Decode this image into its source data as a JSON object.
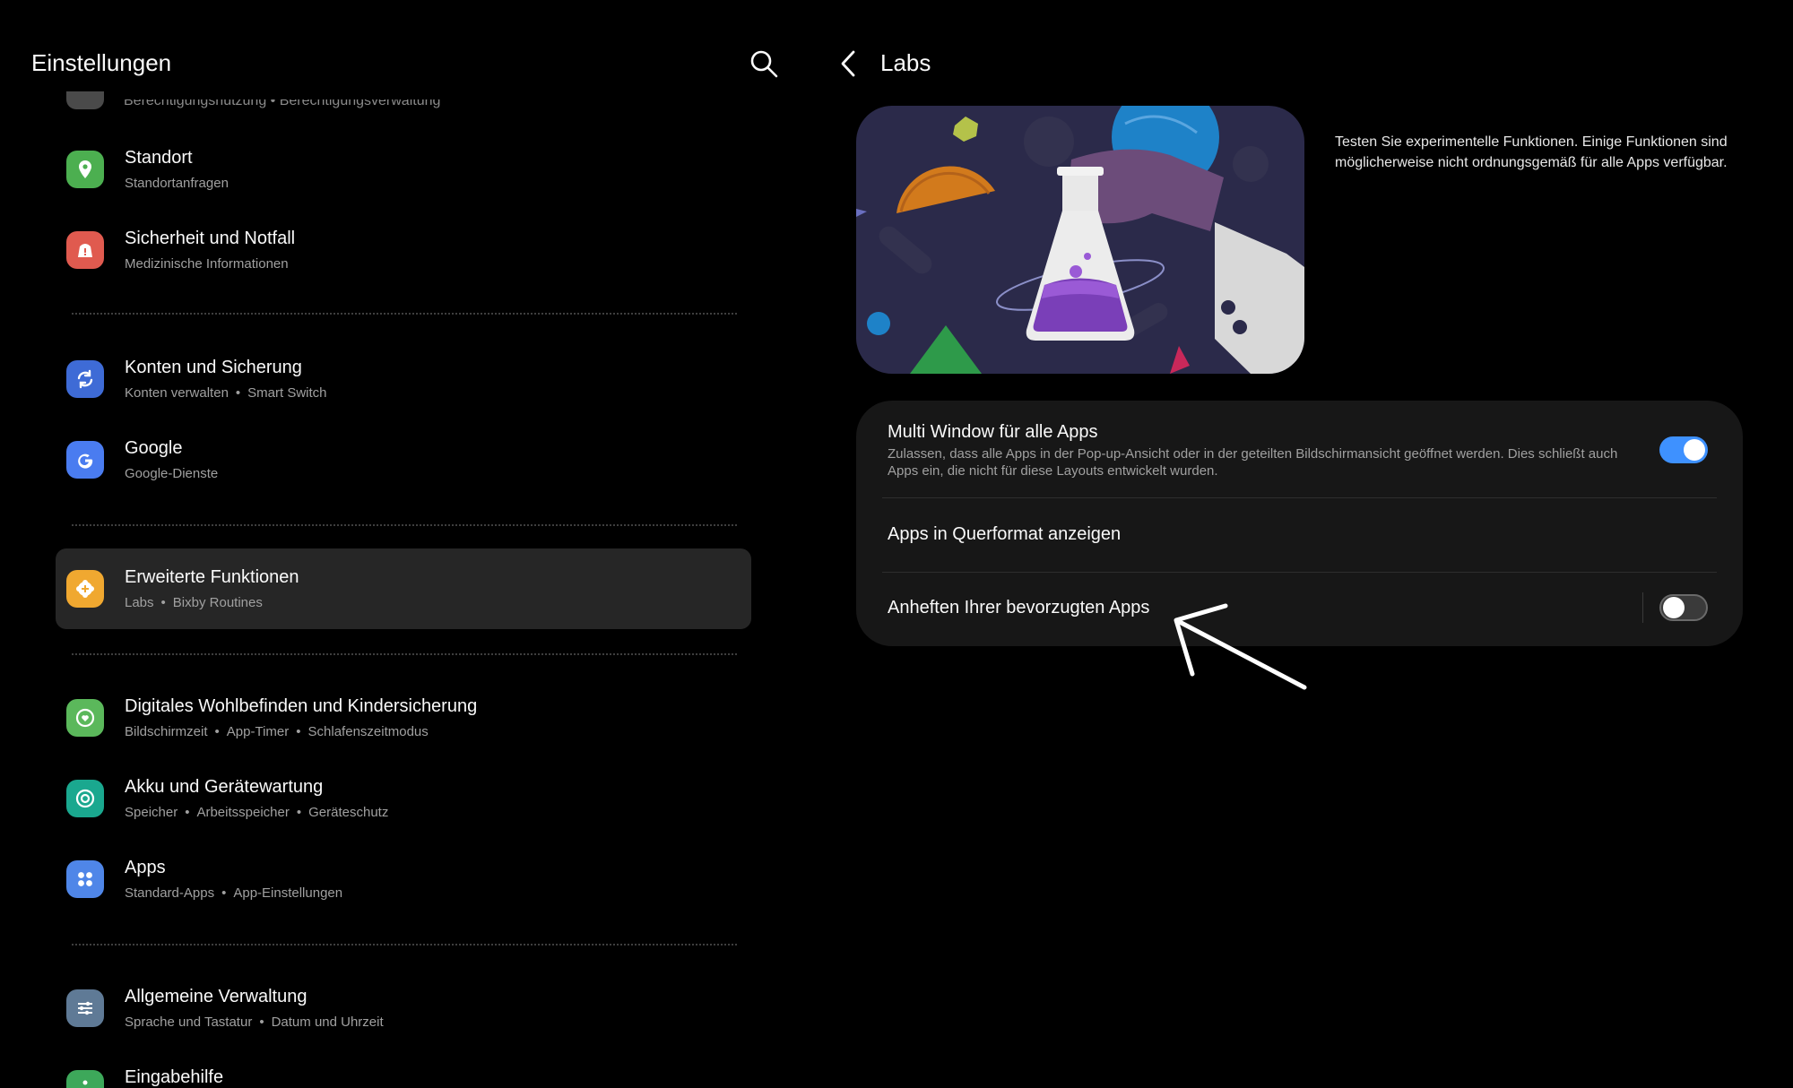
{
  "colors": {
    "background": "#000000",
    "selected_row": "#262626",
    "card": "#171717",
    "toggle_on": "#3e91ff",
    "toggle_off": "#3a3a3a"
  },
  "left": {
    "title": "Einstellungen",
    "search_icon": "search-icon",
    "clipped_item_text": "Berechtigungsnutzung • Berechtigungsverwaltung",
    "items": [
      {
        "id": "standort",
        "title": "Standort",
        "subtitle": [
          "Standortanfragen"
        ],
        "icon": "location-pin-icon",
        "icon_color": "#4caf50"
      },
      {
        "id": "sicherheit",
        "title": "Sicherheit und Notfall",
        "subtitle": [
          "Medizinische Informationen"
        ],
        "icon": "emergency-icon",
        "icon_color": "#e05a4f"
      },
      {
        "id": "konten",
        "title": "Konten und Sicherung",
        "subtitle": [
          "Konten verwalten",
          "Smart Switch"
        ],
        "icon": "sync-icon",
        "icon_color": "#3e6bd6"
      },
      {
        "id": "google",
        "title": "Google",
        "subtitle": [
          "Google-Dienste"
        ],
        "icon": "google-icon",
        "icon_color": "#4a7cf0"
      },
      {
        "id": "erweitert",
        "title": "Erweiterte Funktionen",
        "subtitle": [
          "Labs",
          "Bixby Routines"
        ],
        "icon": "gear-plus-icon",
        "icon_color": "#f0a830",
        "selected": true
      },
      {
        "id": "wohlbefinden",
        "title": "Digitales Wohlbefinden und Kindersicherung",
        "subtitle": [
          "Bildschirmzeit",
          "App-Timer",
          "Schlafenszeitmodus"
        ],
        "icon": "heart-circle-icon",
        "icon_color": "#5bb85b"
      },
      {
        "id": "akku",
        "title": "Akku und Gerätewartung",
        "subtitle": [
          "Speicher",
          "Arbeitsspeicher",
          "Geräteschutz"
        ],
        "icon": "battery-care-icon",
        "icon_color": "#1aa88f"
      },
      {
        "id": "apps",
        "title": "Apps",
        "subtitle": [
          "Standard-Apps",
          "App-Einstellungen"
        ],
        "icon": "apps-grid-icon",
        "icon_color": "#4f86e8"
      },
      {
        "id": "allgemein",
        "title": "Allgemeine Verwaltung",
        "subtitle": [
          "Sprache und Tastatur",
          "Datum und Uhrzeit"
        ],
        "icon": "sliders-icon",
        "icon_color": "#5f7a96"
      },
      {
        "id": "eingabehilfe",
        "title": "Eingabehilfe",
        "subtitle": [],
        "icon": "accessibility-icon",
        "icon_color": "#3da85a"
      }
    ]
  },
  "right": {
    "back_icon": "back-arrow-icon",
    "title": "Labs",
    "hero_description": "Testen Sie experimentelle Funktionen. Einige Funktionen sind möglicherweise nicht ordnungsgemäß für alle Apps verfügbar.",
    "hero_image": "labs-flask-illustration",
    "rows": [
      {
        "title": "Multi Window für alle Apps",
        "description": "Zulassen, dass alle Apps in der Pop-up-Ansicht oder in der geteilten Bildschirmansicht geöffnet werden. Dies schließt auch Apps ein, die nicht für diese Layouts entwickelt wurden.",
        "toggle": "on"
      },
      {
        "title": "Apps in Querformat anzeigen"
      },
      {
        "title": "Anheften Ihrer bevorzugten Apps",
        "toggle": "off"
      }
    ],
    "annotation": "hand-drawn-arrow"
  }
}
